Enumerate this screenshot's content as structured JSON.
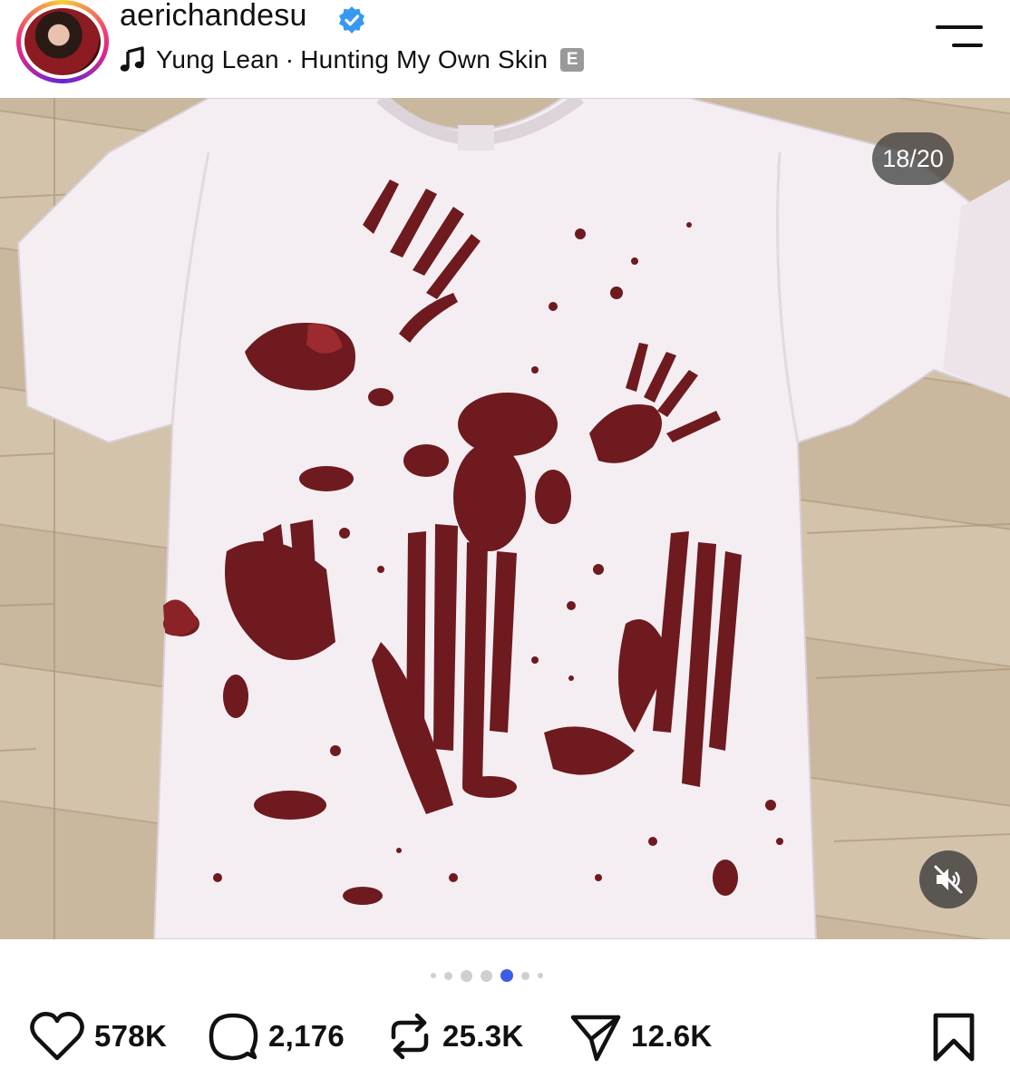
{
  "post": {
    "username": "aerichandesu",
    "verified": true,
    "music": {
      "artist": "Yung Lean",
      "separator": "·",
      "song": "Hunting My Own Skin",
      "explicit_badge": "E"
    },
    "carousel": {
      "counter": "18/20",
      "current": 18,
      "total": 20
    },
    "actions": {
      "likes": "578K",
      "comments": "2,176",
      "reposts": "25.3K",
      "shares": "12.6K"
    }
  },
  "icons": {
    "verified": "verified-badge-icon",
    "music": "music-note-icon",
    "menu": "menu-icon",
    "mute": "speaker-muted-icon",
    "like": "heart-icon",
    "comment": "comment-bubble-icon",
    "repost": "repost-icon",
    "share": "send-icon",
    "save": "bookmark-icon"
  },
  "colors": {
    "accent": "#3b5de7",
    "verified": "#3897f0",
    "stain": "#6e1a1f"
  }
}
